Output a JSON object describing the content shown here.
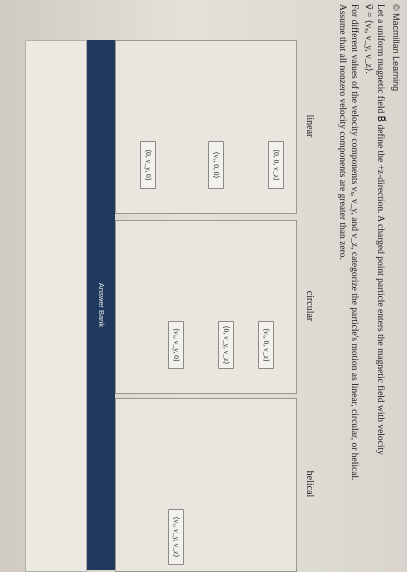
{
  "credit": "© Macmillan Learning",
  "question": {
    "line1": "Let a uniform magnetic field B⃗ define the +z-direction. A charged point particle enters the magnetic field with velocity",
    "line2": "v⃗ = ⟨vₓ, v_y, v_z⟩.",
    "line3": "For different values of the velocity components vₓ, v_y, and v_z, categorize the particle's motion as linear, circular, or helical.",
    "line4": "Assume that all nonzero velocity components are greater than zero."
  },
  "columns": {
    "linear": "linear",
    "circular": "circular",
    "helical": "helical"
  },
  "tiles": {
    "linear": [
      "⟨0, 0, v_z⟩",
      "⟨vₓ, 0, 0⟩",
      "⟨0, v_y, 0⟩"
    ],
    "circular": [
      "⟨vₓ, 0, v_z⟩",
      "⟨0, v_y, v_z⟩",
      "⟨vₓ, v_y, 0⟩"
    ],
    "helical": [
      "⟨vₓ, v_y, v_z⟩"
    ]
  },
  "answer_bank": {
    "label": "Answer Bank"
  }
}
